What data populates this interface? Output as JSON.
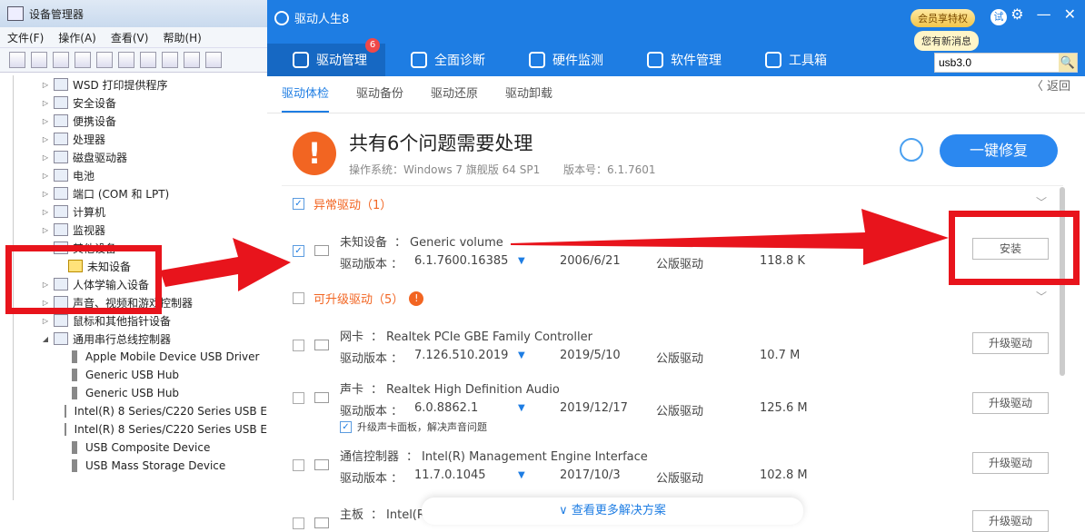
{
  "devmgr": {
    "title": "设备管理器",
    "menu": [
      "文件(F)",
      "操作(A)",
      "查看(V)",
      "帮助(H)"
    ],
    "tree": [
      {
        "label": "WSD 打印提供程序",
        "exp": "▷"
      },
      {
        "label": "安全设备",
        "exp": "▷"
      },
      {
        "label": "便携设备",
        "exp": "▷"
      },
      {
        "label": "处理器",
        "exp": "▷"
      },
      {
        "label": "磁盘驱动器",
        "exp": "▷"
      },
      {
        "label": "电池",
        "exp": "▷"
      },
      {
        "label": "端口 (COM 和 LPT)",
        "exp": "▷"
      },
      {
        "label": "计算机",
        "exp": "▷"
      },
      {
        "label": "监视器",
        "exp": "▷"
      },
      {
        "label": "其他设备",
        "exp": "◢"
      },
      {
        "label": "未知设备",
        "exp": ""
      },
      {
        "label": "人体学输入设备",
        "exp": "▷"
      },
      {
        "label": "声音、视频和游戏控制器",
        "exp": "▷"
      },
      {
        "label": "鼠标和其他指针设备",
        "exp": "▷"
      },
      {
        "label": "通用串行总线控制器",
        "exp": "◢"
      },
      {
        "label": "Apple Mobile Device USB Driver",
        "exp": ""
      },
      {
        "label": "Generic USB Hub",
        "exp": ""
      },
      {
        "label": "Generic USB Hub",
        "exp": ""
      },
      {
        "label": "Intel(R) 8 Series/C220 Series USB E",
        "exp": ""
      },
      {
        "label": "Intel(R) 8 Series/C220 Series USB E",
        "exp": ""
      },
      {
        "label": "USB Composite Device",
        "exp": ""
      },
      {
        "label": "USB Mass Storage Device",
        "exp": ""
      }
    ]
  },
  "app": {
    "title": "驱动人生8",
    "vip_label": "会员享特权",
    "notice": "您有新消息",
    "user_initial": "试",
    "nav": [
      {
        "label": "驱动管理",
        "badge": "6"
      },
      {
        "label": "全面诊断"
      },
      {
        "label": "硬件监测"
      },
      {
        "label": "软件管理"
      },
      {
        "label": "工具箱"
      }
    ],
    "search_value": "usb3.0",
    "subtabs": [
      "驱动体检",
      "驱动备份",
      "驱动还原",
      "驱动卸载"
    ],
    "back_label": "〈 返回",
    "summary_title": "共有6个问题需要处理",
    "summary_os": "操作系统：Windows 7 旗舰版  64 SP1",
    "summary_version": "版本号：6.1.7601",
    "fix_all_label": "一键修复",
    "section_abnormal": "异常驱动（1）",
    "section_upgrade": "可升级驱动（5）",
    "drivers": [
      {
        "type": "未知设备",
        "name": "Generic volume",
        "version": "6.1.7600.16385",
        "date": "2006/6/21",
        "kind": "公版驱动",
        "size": "118.8 K",
        "action": "安装"
      },
      {
        "type": "网卡",
        "name": "Realtek PCIe GBE Family Controller",
        "version": "7.126.510.2019",
        "date": "2019/5/10",
        "kind": "公版驱动",
        "size": "10.7 M",
        "action": "升级驱动"
      },
      {
        "type": "声卡",
        "name": "Realtek High Definition Audio",
        "version": "6.0.8862.1",
        "date": "2019/12/17",
        "kind": "公版驱动",
        "size": "125.6 M",
        "action": "升级驱动",
        "extra": "升级声卡面板，解决声音问题"
      },
      {
        "type": "通信控制器",
        "name": "Intel(R) Management Engine Interface",
        "version": "11.7.0.1045",
        "date": "2017/10/3",
        "kind": "公版驱动",
        "size": "102.8 M",
        "action": "升级驱动"
      },
      {
        "type": "主板",
        "name": "Intel(R",
        "version": "",
        "date": "",
        "kind": "",
        "size": "",
        "action": "升级驱动"
      }
    ],
    "version_prefix": "驱动版本 ：",
    "sep": "：",
    "more_label": "∨ 查看更多解决方案"
  }
}
